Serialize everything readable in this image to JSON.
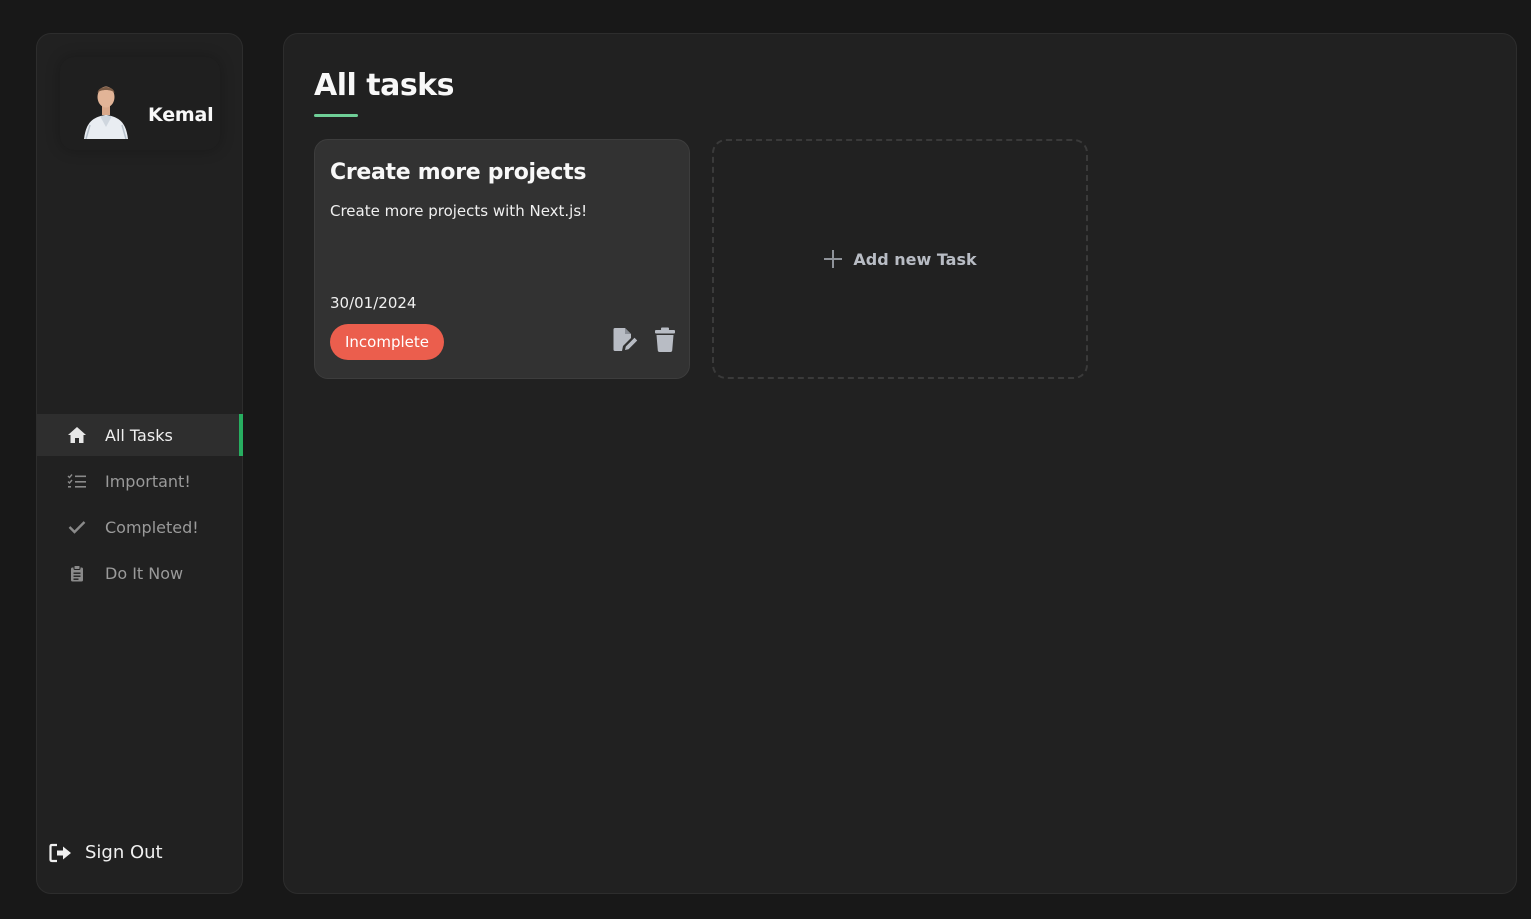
{
  "profile": {
    "name": "Kemal"
  },
  "sidebar": {
    "items": [
      {
        "label": "All Tasks",
        "icon": "home-icon",
        "active": true
      },
      {
        "label": "Important!",
        "icon": "list-check-icon",
        "active": false
      },
      {
        "label": "Completed!",
        "icon": "check-icon",
        "active": false
      },
      {
        "label": "Do It Now",
        "icon": "clipboard-icon",
        "active": false
      }
    ],
    "signout_label": "Sign Out",
    "signout_icon": "sign-out-icon"
  },
  "main": {
    "title": "All tasks",
    "tasks": [
      {
        "title": "Create more projects",
        "description": "Create more projects with Next.js!",
        "date": "30/01/2024",
        "status": "Incomplete"
      }
    ],
    "add_task_label": "Add new Task"
  },
  "colors": {
    "accent": "#27ae60",
    "underline": "#6fcf97",
    "incomplete": "#eb5e4d",
    "background": "#181818",
    "panel": "#212121",
    "card": "#323232"
  }
}
